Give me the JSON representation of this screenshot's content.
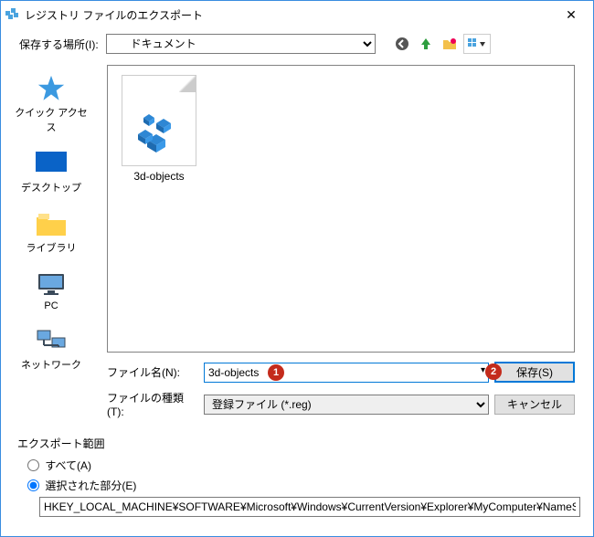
{
  "window": {
    "title": "レジストリ ファイルのエクスポート"
  },
  "toolbar": {
    "save_in_label": "保存する場所(I):",
    "location_selected": "ドキュメント"
  },
  "places": {
    "items": [
      {
        "label": "クイック アクセス"
      },
      {
        "label": "デスクトップ"
      },
      {
        "label": "ライブラリ"
      },
      {
        "label": "PC"
      },
      {
        "label": "ネットワーク"
      }
    ]
  },
  "listing": {
    "items": [
      {
        "name": "3d-objects"
      }
    ]
  },
  "form": {
    "filename_label": "ファイル名(N):",
    "filename_value": "3d-objects",
    "filetype_label": "ファイルの種類(T):",
    "filetype_value": "登録ファイル (*.reg)",
    "save_label": "保存(S)",
    "cancel_label": "キャンセル"
  },
  "export_range": {
    "title": "エクスポート範囲",
    "opt_all": "すべて(A)",
    "opt_selected": "選択された部分(E)",
    "path": "HKEY_LOCAL_MACHINE¥SOFTWARE¥Microsoft¥Windows¥CurrentVersion¥Explorer¥MyComputer¥NameSpa"
  },
  "annotations": {
    "badge1": "1",
    "badge2": "2"
  }
}
